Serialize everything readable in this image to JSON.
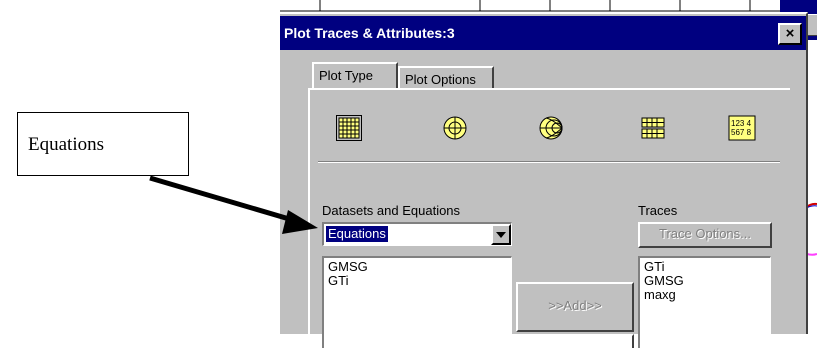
{
  "dialog": {
    "title": "Plot Traces & Attributes:3",
    "close_label": "×",
    "tabs": [
      {
        "label": "Plot Type",
        "active": true
      },
      {
        "label": "Plot Options",
        "active": false
      }
    ],
    "plot_type_icons": [
      "rectangular-plot-icon",
      "polar-plot-icon",
      "smith-chart-icon",
      "stacked-plot-icon",
      "list-plot-icon"
    ],
    "list_icon_text": {
      "line1": "123 4",
      "line2": "567 8"
    },
    "datasets_label": "Datasets and Equations",
    "dataset_selected": "Equations",
    "dataset_items": [
      "GMSG",
      "GTi"
    ],
    "traces_label": "Traces",
    "trace_options_label": "Trace Options...",
    "trace_items": [
      "GTi",
      "GMSG",
      "maxg"
    ],
    "add_label": ">>Add>>"
  },
  "annotation": {
    "callout_text": "Equations"
  },
  "colors": {
    "title_bar": "#000080",
    "dialog_face": "#c0c0c0",
    "selection": "#000080",
    "icon_yellow": "#ffff80"
  }
}
